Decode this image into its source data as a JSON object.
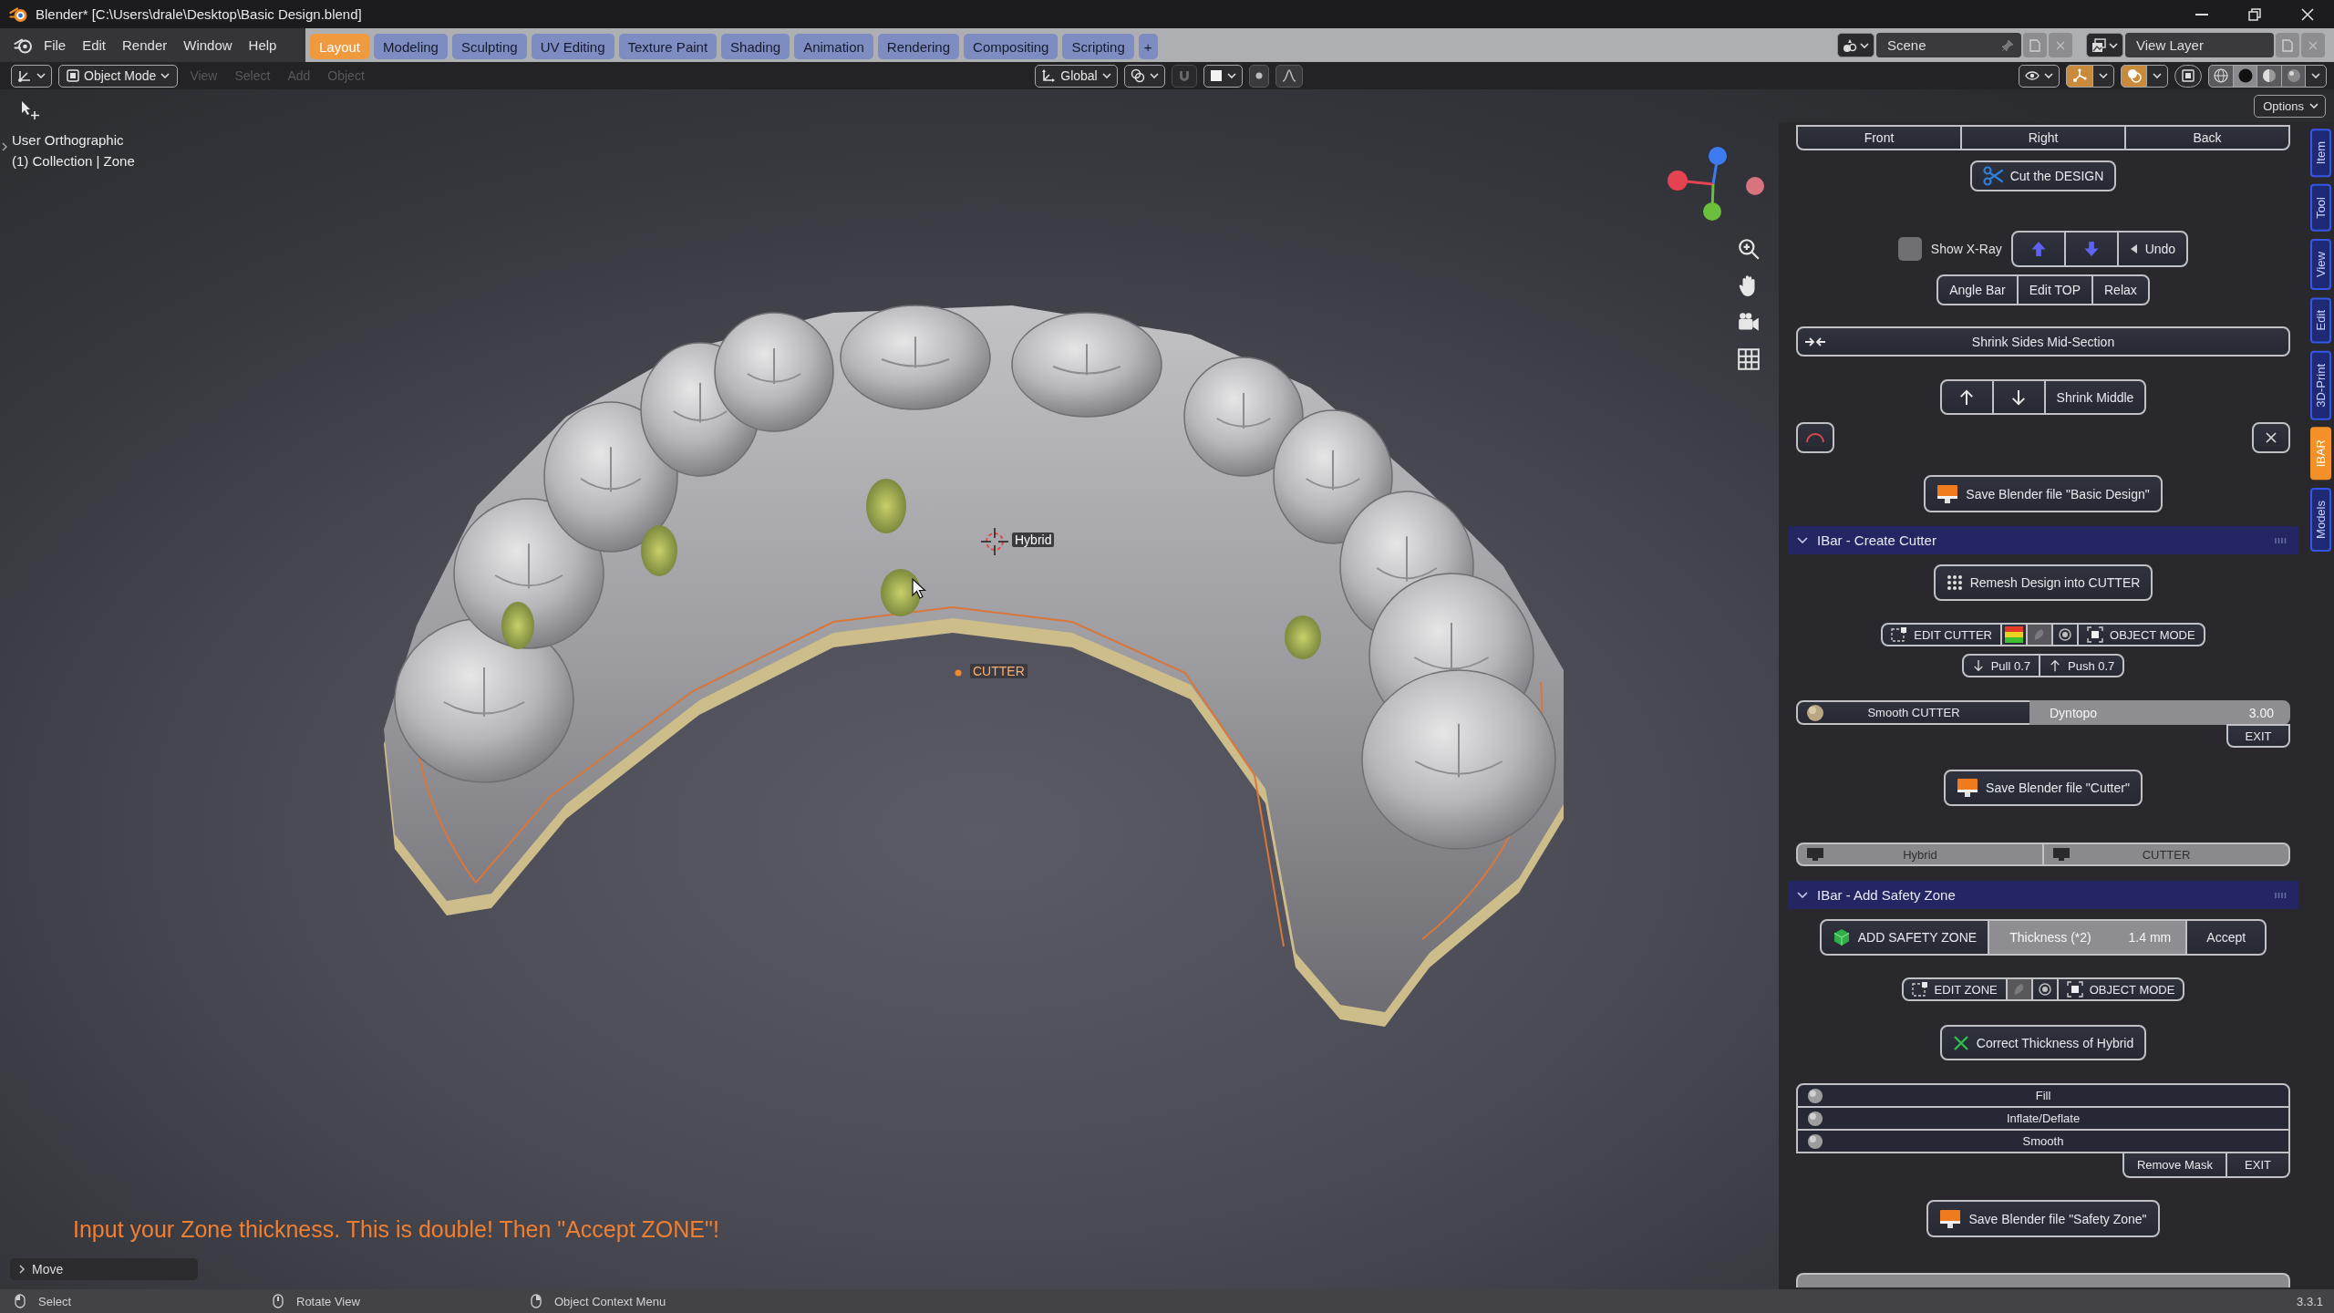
{
  "window": {
    "title": "Blender* [C:\\Users\\drale\\Desktop\\Basic Design.blend]"
  },
  "top_bar": {
    "menus": [
      "File",
      "Edit",
      "Render",
      "Window",
      "Help"
    ],
    "workspace_tabs": [
      {
        "label": "Layout",
        "selected": true
      },
      {
        "label": "Modeling",
        "selected": false
      },
      {
        "label": "Sculpting",
        "selected": false
      },
      {
        "label": "UV Editing",
        "selected": false
      },
      {
        "label": "Texture Paint",
        "selected": false
      },
      {
        "label": "Shading",
        "selected": false
      },
      {
        "label": "Animation",
        "selected": false
      },
      {
        "label": "Rendering",
        "selected": false
      },
      {
        "label": "Compositing",
        "selected": false
      },
      {
        "label": "Scripting",
        "selected": false
      }
    ],
    "add_tab": "+",
    "scene": "Scene",
    "view_layer": "View Layer"
  },
  "viewport_header": {
    "mode": "Object Mode",
    "menus": [
      "View",
      "Select",
      "Add",
      "Object"
    ],
    "orientation": "Global",
    "gizmo_toggle": {
      "on": true
    },
    "overlay_toggle": {
      "on": true
    },
    "xray_toggle": {
      "on": false
    },
    "shading_modes": [
      {
        "kind": "wireframe",
        "selected": false
      },
      {
        "kind": "solid",
        "selected": true
      },
      {
        "kind": "material",
        "selected": false
      },
      {
        "kind": "rendered",
        "selected": false
      }
    ]
  },
  "viewport": {
    "view_name": "User Orthographic",
    "collection": "(1) Collection | Zone",
    "object_labels": [
      {
        "text": "Hybrid",
        "selected": false
      },
      {
        "text": "CUTTER",
        "selected": true
      }
    ],
    "message": "Input your Zone thickness. This is double! Then \"Accept ZONE\"!",
    "last_operator": {
      "label": "Move",
      "expanded": false
    },
    "options_button": "Options"
  },
  "sidebar": {
    "tabs": [
      {
        "label": "Item",
        "selected": false
      },
      {
        "label": "Tool",
        "selected": false
      },
      {
        "label": "View",
        "selected": false
      },
      {
        "label": "Edit",
        "selected": false
      },
      {
        "label": "3D-Print",
        "selected": false
      },
      {
        "label": "IBAR",
        "selected": true
      },
      {
        "label": "Models",
        "selected": false
      }
    ],
    "view_buttons": [
      "Front",
      "Right",
      "Back"
    ],
    "cut_button": "Cut the DESIGN",
    "xray": {
      "label": "Show X-Ray",
      "checked": false
    },
    "undo_button": "Undo",
    "edit_buttons": [
      "Angle Bar",
      "Edit TOP",
      "Relax"
    ],
    "shrink_sides_button": "Shrink Sides Mid-Section",
    "shrink_middle_button": "Shrink Middle",
    "save_button": "Save Blender file \"Basic Design\"",
    "create_cutter": {
      "title": "IBar - Create Cutter",
      "expanded": true,
      "remesh_button": "Remesh Design into CUTTER",
      "edit_button": "EDIT CUTTER",
      "object_mode_button": "OBJECT MODE",
      "pull_button": "Pull 0.7",
      "push_button": "Push 0.7",
      "smooth_button": "Smooth CUTTER",
      "dyntopo": {
        "label": "Dyntopo",
        "value": "3.00"
      },
      "exit_button": "EXIT",
      "save_button": "Save Blender file \"Cutter\"",
      "object_toggles": [
        "Hybrid",
        "CUTTER"
      ]
    },
    "safety_zone": {
      "title": "IBar - Add Safety Zone",
      "expanded": true,
      "add_button": "ADD SAFETY ZONE",
      "thickness": {
        "label": "Thickness (*2)",
        "value": "1.4 mm"
      },
      "accept_button": "Accept",
      "edit_button": "EDIT ZONE",
      "object_mode_button": "OBJECT MODE",
      "correct_button": "Correct Thickness of Hybrid",
      "brushes": [
        "Fill",
        "Inflate/Deflate",
        "Smooth"
      ],
      "remove_mask_button": "Remove Mask",
      "exit_button": "EXIT",
      "save_button": "Save Blender file \"Safety Zone\""
    }
  },
  "status_bar": {
    "hints": [
      {
        "kind": "left",
        "label": "Select"
      },
      {
        "kind": "middle",
        "label": "Rotate View"
      },
      {
        "kind": "right",
        "label": "Object Context Menu"
      }
    ],
    "version": "3.3.1"
  }
}
